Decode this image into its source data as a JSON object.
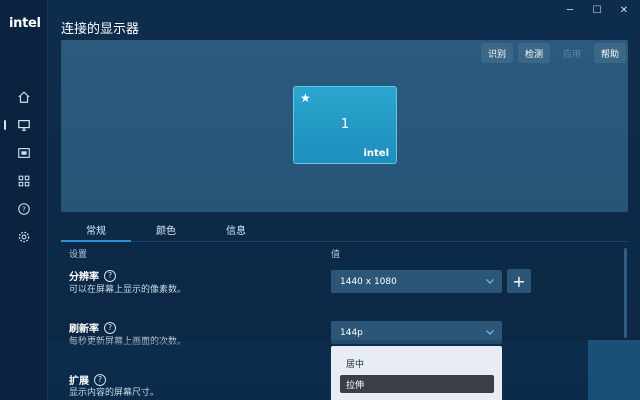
{
  "app": {
    "logo": "intel"
  },
  "window": {
    "minimize": "─",
    "maximize": "☐",
    "close": "✕"
  },
  "page": {
    "title": "连接的显示器"
  },
  "preview": {
    "buttons": [
      {
        "label": "识别",
        "enabled": true
      },
      {
        "label": "检测",
        "enabled": true
      },
      {
        "label": "应用",
        "enabled": false
      },
      {
        "label": "帮助",
        "enabled": true
      }
    ],
    "monitor": {
      "star": "★",
      "number": "1",
      "brand": "intel"
    }
  },
  "tabs": [
    {
      "label": "常规",
      "active": true
    },
    {
      "label": "颜色",
      "active": false
    },
    {
      "label": "信息",
      "active": false
    }
  ],
  "table": {
    "col_setting": "设置",
    "col_value": "值"
  },
  "settings": {
    "resolution": {
      "title": "分辨率",
      "help": "?",
      "desc": "可以在屏幕上显示的像素数。",
      "value": "1440 x 1080",
      "add": "+"
    },
    "refresh": {
      "title": "刷新率",
      "help": "?",
      "desc": "每秒更新屏幕上画面的次数。",
      "value": "144p"
    },
    "scaling": {
      "title": "扩展",
      "help": "?",
      "desc": "显示内容的屏幕尺寸。"
    }
  },
  "dropdown": {
    "options": [
      {
        "label": "居中",
        "selected": false
      },
      {
        "label": "拉伸",
        "selected": true
      }
    ]
  },
  "icons": {
    "nav": [
      "home-icon",
      "display-icon",
      "video-icon",
      "apps-grid-icon",
      "help-circle-icon",
      "gear-icon"
    ]
  },
  "colors": {
    "accent": "#2c8fd6",
    "background": "#0d2a47",
    "monitor": "#1d9ac6"
  }
}
